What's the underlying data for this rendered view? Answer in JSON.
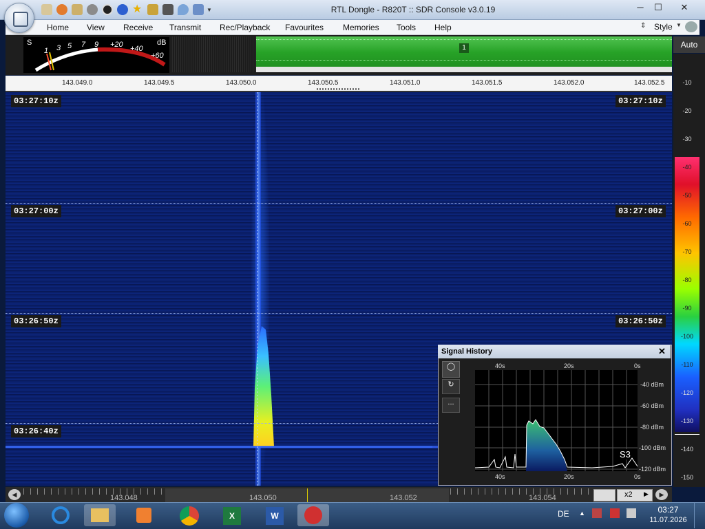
{
  "window": {
    "title": "RTL Dongle - R820T :: SDR Console v3.0.19"
  },
  "menu": {
    "items": [
      "Home",
      "View",
      "Receive",
      "Transmit",
      "Rec/Playback",
      "Favourites",
      "Memories",
      "Tools",
      "Help"
    ],
    "style_label": "Style"
  },
  "meter": {
    "s_label": "S",
    "db_label": "dB",
    "scale": [
      "1",
      "3",
      "5",
      "7",
      "9",
      "+20",
      "+40",
      "+60"
    ]
  },
  "band": {
    "marker": "1"
  },
  "freq_scale": [
    "143.049.0",
    "143.049.5",
    "143.050.0",
    "143.050.5",
    "143.051.0",
    "143.051.5",
    "143.052.0",
    "143.052.5"
  ],
  "timestamps": [
    "03:27:10z",
    "03:27:00z",
    "03:26:50z",
    "03:26:40z"
  ],
  "colour_scale": {
    "auto_label": "Auto",
    "levels": [
      "-10",
      "-20",
      "-30",
      "-40",
      "-50",
      "-60",
      "-70",
      "-80",
      "-90",
      "-100",
      "-110",
      "-120",
      "-130",
      "-140",
      "-150"
    ]
  },
  "bottom_scale": [
    "143.048",
    "143.050",
    "143.052",
    "143.054"
  ],
  "zoom": "x2",
  "signal_history": {
    "title": "Signal History",
    "top_time_labels": [
      "40s",
      "20s",
      "0s"
    ],
    "bottom_time_labels": [
      "40s",
      "20s",
      "0s"
    ],
    "dbm_labels": [
      "-40 dBm",
      "-60 dBm",
      "-80 dBm",
      "-100 dBm",
      "-120 dBm"
    ],
    "s_reading": "S3",
    "menu_btn": "..."
  },
  "taskbar": {
    "lang": "DE",
    "time": "03:27",
    "date": "11.07.2026"
  }
}
